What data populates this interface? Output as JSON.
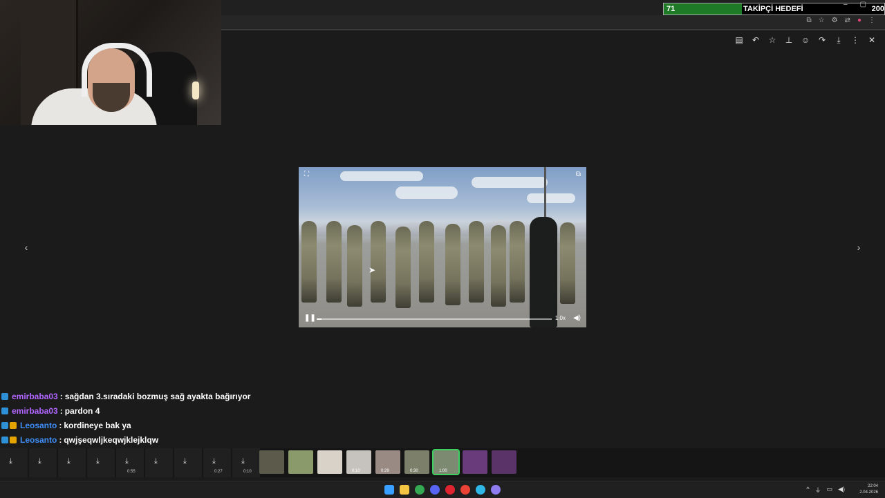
{
  "goal": {
    "count": "71",
    "label": "TAKİPÇİ HEDEFİ",
    "target": "200",
    "progress_fraction": 0.355
  },
  "browser": {
    "window_controls": [
      "–",
      "▢",
      "✕"
    ],
    "tools": [
      "⧉",
      "☆",
      "⚙",
      "⇄",
      "●",
      "⋮"
    ]
  },
  "viewer_toolbar": [
    {
      "name": "caption-icon",
      "glyph": "▤"
    },
    {
      "name": "reply-icon",
      "glyph": "↶"
    },
    {
      "name": "star-icon",
      "glyph": "☆"
    },
    {
      "name": "pin-icon",
      "glyph": "⊥"
    },
    {
      "name": "emoji-icon",
      "glyph": "☺"
    },
    {
      "name": "share-icon",
      "glyph": "↷"
    },
    {
      "name": "download-icon",
      "glyph": "⤓"
    },
    {
      "name": "more-icon",
      "glyph": "⋮"
    },
    {
      "name": "close-icon",
      "glyph": "✕"
    }
  ],
  "nav": {
    "prev": "‹",
    "next": "›"
  },
  "video": {
    "speed": "1.0x",
    "progress_fraction": 0.02
  },
  "chat": [
    {
      "badges": [
        "blue"
      ],
      "user": "emirbaba03",
      "user_color": "#b266ff",
      "text": "sağdan 3.sıradaki bozmuş sağ ayakta bağırıyor"
    },
    {
      "badges": [
        "blue"
      ],
      "user": "emirbaba03",
      "user_color": "#b266ff",
      "text": "pardon 4"
    },
    {
      "badges": [
        "blue",
        "gold"
      ],
      "user": "Leosanto",
      "user_color": "#3e8ef7",
      "text": "kordineye bak ya"
    },
    {
      "badges": [
        "blue",
        "gold"
      ],
      "user": "Leosanto",
      "user_color": "#3e8ef7",
      "text": "qwjşeqwljkeqwjklejklqw"
    }
  ],
  "media_strip": {
    "downloads": [
      {
        "duration": ""
      },
      {
        "duration": ""
      },
      {
        "duration": ""
      },
      {
        "duration": ""
      },
      {
        "duration": "0:55"
      },
      {
        "duration": ""
      },
      {
        "duration": ""
      },
      {
        "duration": "0:27"
      },
      {
        "duration": "0:10"
      }
    ],
    "thumbs": [
      {
        "duration": "",
        "color": "#5c5a4a"
      },
      {
        "duration": "",
        "color": "#8a9a6a"
      },
      {
        "duration": "",
        "color": "#d9d2c8"
      },
      {
        "duration": "0:10",
        "color": "#c6c2bd"
      },
      {
        "duration": "0:29",
        "color": "#9a8a84"
      },
      {
        "duration": "0:30",
        "color": "#7c806a"
      },
      {
        "duration": "1:00",
        "color": "#7d8a72",
        "active": true
      },
      {
        "duration": "",
        "color": "#6a3b7a"
      },
      {
        "duration": "",
        "color": "#5a3368"
      }
    ]
  },
  "taskbar": {
    "apps": [
      {
        "name": "start-icon",
        "color": "#3aa0ff"
      },
      {
        "name": "explorer-icon",
        "color": "#f4c542"
      },
      {
        "name": "chrome-icon",
        "color": "#34a853"
      },
      {
        "name": "discord-icon",
        "color": "#5865f2"
      },
      {
        "name": "opera-icon",
        "color": "#e0242f"
      },
      {
        "name": "chrome2-icon",
        "color": "#ea4335"
      },
      {
        "name": "edge-icon",
        "color": "#2fb7e8"
      },
      {
        "name": "obs-icon",
        "color": "#8f7cf0"
      }
    ],
    "tray": [
      "^",
      "⏚",
      "▭",
      "◀)"
    ],
    "time": "22:04",
    "date": "2.04.2026"
  }
}
